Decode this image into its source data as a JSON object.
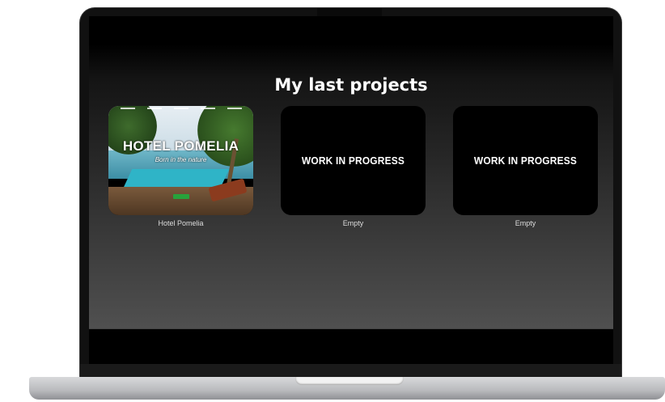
{
  "page": {
    "title": "My last projects"
  },
  "projects": [
    {
      "caption": "Hotel Pomelia",
      "thumbnail_title": "HOTEL POMELIA",
      "thumbnail_subtitle": "Born in the nature",
      "type": "screenshot"
    },
    {
      "caption": "Empty",
      "thumbnail_text": "WORK IN PROGRESS",
      "type": "placeholder"
    },
    {
      "caption": "Empty",
      "thumbnail_text": "WORK IN PROGRESS",
      "type": "placeholder"
    }
  ],
  "colors": {
    "screen_bg_top": "#000000",
    "screen_bg_bottom": "#505050",
    "card_bg": "#000000",
    "text": "#ffffff",
    "laptop_bezel": "#111111",
    "laptop_base": "#c2c3c6"
  }
}
